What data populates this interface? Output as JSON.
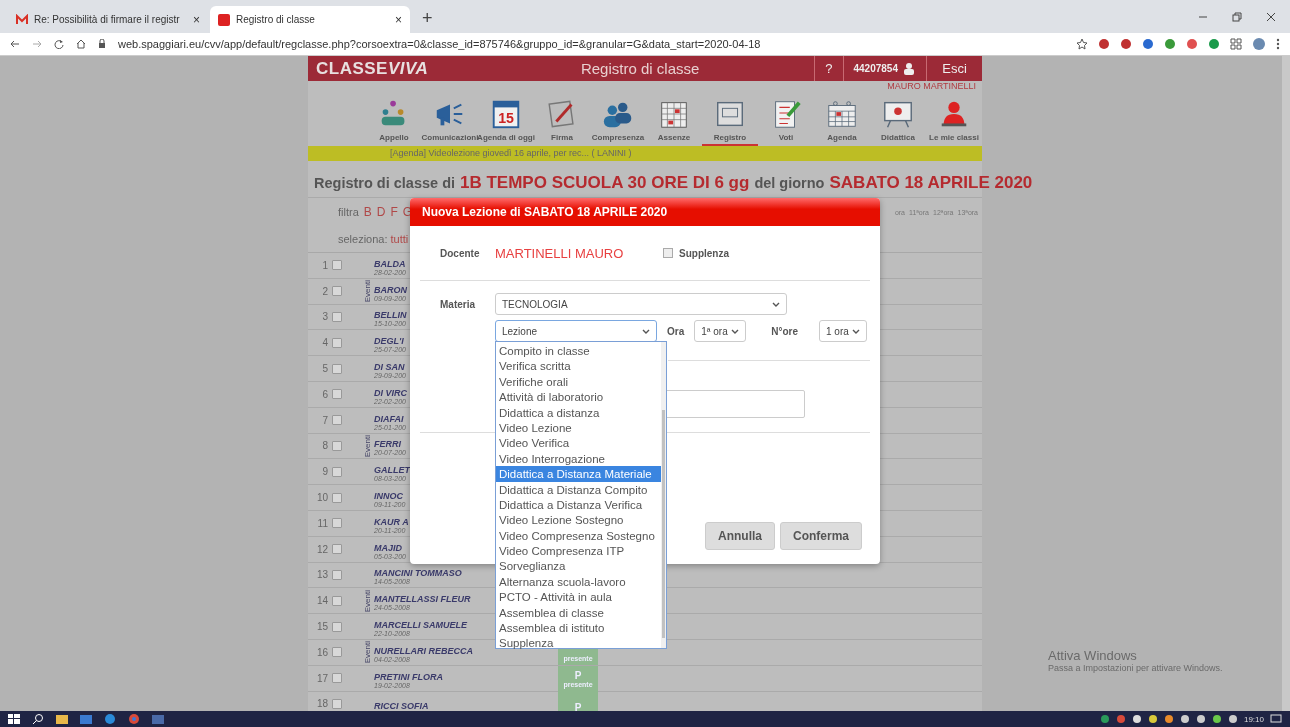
{
  "browser": {
    "tabs": [
      {
        "title": "Re: Possibilità di firmare il registr",
        "close": "×",
        "selected": false
      },
      {
        "title": "Registro di classe",
        "close": "×",
        "selected": true
      }
    ],
    "new_tab": "+",
    "url": "web.spaggiari.eu/cvv/app/default/regclasse.php?corsoextra=0&classe_id=875746&gruppo_id=&granular=G&data_start=2020-04-18"
  },
  "header": {
    "logo": {
      "main": "CLASSE",
      "accent": "VIVA"
    },
    "title": "Registro di classe",
    "help": "?",
    "user_code": "44207854",
    "logout": "Esci",
    "user_name": "MAURO MARTINELLI"
  },
  "nav": [
    {
      "label": "Appello",
      "selected": false
    },
    {
      "label": "Comunicazioni",
      "selected": false
    },
    {
      "label": "Agenda di oggi",
      "selected": false,
      "icon_text": "15"
    },
    {
      "label": "Firma",
      "selected": false
    },
    {
      "label": "Compresenza",
      "selected": false
    },
    {
      "label": "Assenze",
      "selected": false
    },
    {
      "label": "Registro",
      "selected": true
    },
    {
      "label": "Voti",
      "selected": false
    },
    {
      "label": "Agenda",
      "selected": false
    },
    {
      "label": "Didattica",
      "selected": false
    },
    {
      "label": "Le mie classi",
      "selected": false
    }
  ],
  "notice": "[Agenda] Videolezione giovedì 16 aprile, per rec... ( LANINI )",
  "heading": {
    "prefix": "Registro di classe di",
    "class_name": "1B TEMPO SCUOLA 30 ORE DI 6 gg",
    "middle": "del giorno",
    "date": "SABATO 18 APRILE 2020"
  },
  "filter": {
    "label": "filtra",
    "letters": [
      "B",
      "D",
      "F",
      "G"
    ]
  },
  "select_all": {
    "label": "seleziona:",
    "all": "tutti"
  },
  "hours": [
    "ora",
    "11ªora",
    "12ªora",
    "13ªora"
  ],
  "students": [
    {
      "number": "1",
      "checked": false,
      "name": "BALDA",
      "birth": "28-02-200"
    },
    {
      "number": "2",
      "checked": false,
      "events": "Eventi",
      "name": "BARON",
      "birth": "09-09-200"
    },
    {
      "number": "3",
      "checked": false,
      "name": "BELLIN",
      "birth": "15-10-200"
    },
    {
      "number": "4",
      "checked": false,
      "name": "DEGL'I",
      "birth": "25-07-200"
    },
    {
      "number": "5",
      "checked": false,
      "name": "DI SAN",
      "birth": "29-09-200"
    },
    {
      "number": "6",
      "checked": false,
      "name": "DI VIRC",
      "birth": "22-02-200"
    },
    {
      "number": "7",
      "checked": false,
      "name": "DIAFAI",
      "birth": "25-01-200"
    },
    {
      "number": "8",
      "checked": false,
      "events": "Eventi",
      "name": "FERRI",
      "birth": "20-07-200"
    },
    {
      "number": "9",
      "checked": false,
      "name": "GALLET",
      "birth": "08-03-200"
    },
    {
      "number": "10",
      "checked": false,
      "name": "INNOC",
      "birth": "09-11-200"
    },
    {
      "number": "11",
      "checked": false,
      "name": "KAUR A",
      "birth": "20-11-200"
    },
    {
      "number": "12",
      "checked": false,
      "name": "MAJID",
      "birth": "05-03-200"
    },
    {
      "number": "13",
      "checked": false,
      "name": "MANCINI TOMMASO",
      "birth": "14-05-2008"
    },
    {
      "number": "14",
      "checked": false,
      "events": "Eventi",
      "name": "MANTELLASSI FLEUR",
      "birth": "24-05-2008"
    },
    {
      "number": "15",
      "checked": false,
      "name": "MARCELLI SAMUELE",
      "birth": "22-10-2008"
    },
    {
      "number": "16",
      "checked": false,
      "events": "Eventi",
      "name": "NURELLARI REBECCA",
      "birth": "04-02-2008",
      "presence": {
        "label": "presente"
      }
    },
    {
      "number": "17",
      "checked": false,
      "name": "PRETINI FLORA",
      "birth": "19-02-2008",
      "presence": {
        "mark": "P",
        "label": "presente"
      }
    },
    {
      "number": "18",
      "checked": false,
      "name": "RICCI SOFIA",
      "presence": {
        "mark": "P"
      }
    }
  ],
  "modal": {
    "title": "Nuova Lezione di SABATO 18 APRILE 2020",
    "teacher_label": "Docente",
    "teacher": "MARTINELLI MAURO",
    "substitute": {
      "label": "Supplenza",
      "checked": false
    },
    "subject_label": "Materia",
    "subject": "TECNOLOGIA",
    "type": "Lezione",
    "hour_label": "Ora",
    "hour": "1ª ora",
    "count_label": "N°ore",
    "count": "1 ora",
    "type_options": [
      {
        "label": "Compito in classe",
        "selected": false
      },
      {
        "label": "Verifica scritta",
        "selected": false
      },
      {
        "label": "Verifiche orali",
        "selected": false
      },
      {
        "label": "Attività di laboratorio",
        "selected": false
      },
      {
        "label": "Didattica a distanza",
        "selected": false
      },
      {
        "label": "Video Lezione",
        "selected": false
      },
      {
        "label": "Video Verifica",
        "selected": false
      },
      {
        "label": "Video Interrogazione",
        "selected": false
      },
      {
        "label": "Didattica a Distanza Materiale",
        "selected": true
      },
      {
        "label": "Didattica a Distanza Compito",
        "selected": false
      },
      {
        "label": "Didattica a Distanza Verifica",
        "selected": false
      },
      {
        "label": "Video Lezione Sostegno",
        "selected": false
      },
      {
        "label": "Video Compresenza Sostegno",
        "selected": false
      },
      {
        "label": "Video Compresenza ITP",
        "selected": false
      },
      {
        "label": "Sorveglianza",
        "selected": false
      },
      {
        "label": "Alternanza scuola-lavoro",
        "selected": false
      },
      {
        "label": "PCTO - Attività in aula",
        "selected": false
      },
      {
        "label": "Assemblea di classe",
        "selected": false
      },
      {
        "label": "Assemblea di istituto",
        "selected": false
      },
      {
        "label": "Supplenza",
        "selected": false
      }
    ],
    "buttons": [
      "Annulla",
      "Conferma"
    ]
  },
  "watermark": {
    "title": "Attiva Windows",
    "text": "Passa a Impostazioni per attivare Windows."
  },
  "taskbar": {
    "time": "19:10"
  }
}
